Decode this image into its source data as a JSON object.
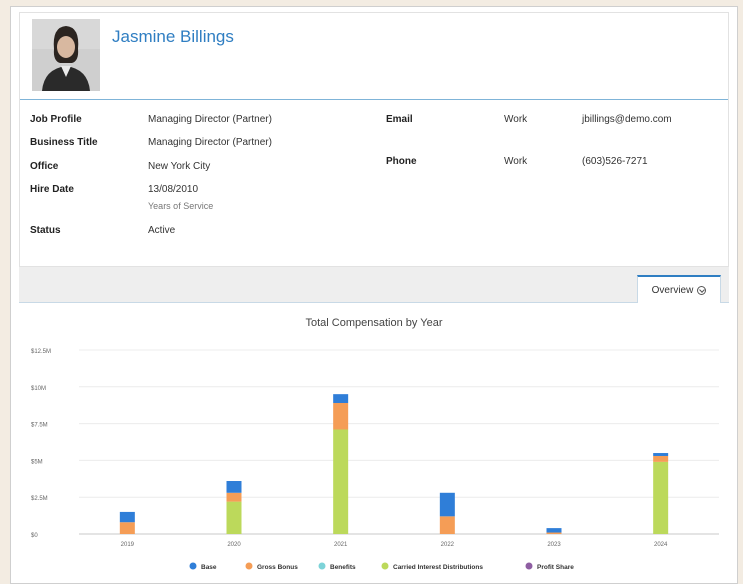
{
  "profile": {
    "name": "Jasmine Billings"
  },
  "details": {
    "left": [
      {
        "label": "Job Profile",
        "value": "Managing Director (Partner)"
      },
      {
        "label": "Business Title",
        "value": "Managing Director (Partner)"
      },
      {
        "label": "Office",
        "value": "New York City"
      },
      {
        "label": "Hire Date",
        "value": "13/08/2010",
        "sub": "Years of Service"
      },
      {
        "label": "Status",
        "value": "Active"
      }
    ],
    "right": [
      {
        "label": "Email",
        "type": "Work",
        "value": "jbillings@demo.com"
      },
      {
        "label": "Phone",
        "type": "Work",
        "value": "(603)526-7271"
      }
    ]
  },
  "tabs": {
    "overview_label": "Overview"
  },
  "chart_data": {
    "type": "bar",
    "stacked": true,
    "title": "Total Compensation by Year",
    "categories": [
      "2019",
      "2020",
      "2021",
      "2022",
      "2023",
      "2024"
    ],
    "y_ticks": [
      "$0",
      "$2.5M",
      "$5M",
      "$7.5M",
      "$10M",
      "$12.5M"
    ],
    "ylim": [
      0,
      12.5
    ],
    "grid": true,
    "legend_position": "bottom",
    "series": [
      {
        "name": "Base",
        "color": "#2f7ed8",
        "values": [
          0.7,
          0.8,
          0.6,
          1.6,
          0.3,
          0.2
        ]
      },
      {
        "name": "Gross Bonus",
        "color": "#f59d56",
        "values": [
          0.8,
          0.6,
          1.8,
          1.2,
          0.1,
          0.4
        ]
      },
      {
        "name": "Benefits",
        "color": "#7dd3d8",
        "values": [
          0,
          0,
          0,
          0,
          0,
          0
        ]
      },
      {
        "name": "Carried Interest Distributions",
        "color": "#bcd95b",
        "values": [
          0,
          2.2,
          7.1,
          0,
          0,
          4.9
        ]
      },
      {
        "name": "Profit Share",
        "color": "#8e5ea2",
        "values": [
          0,
          0,
          0,
          0,
          0,
          0
        ]
      }
    ]
  }
}
